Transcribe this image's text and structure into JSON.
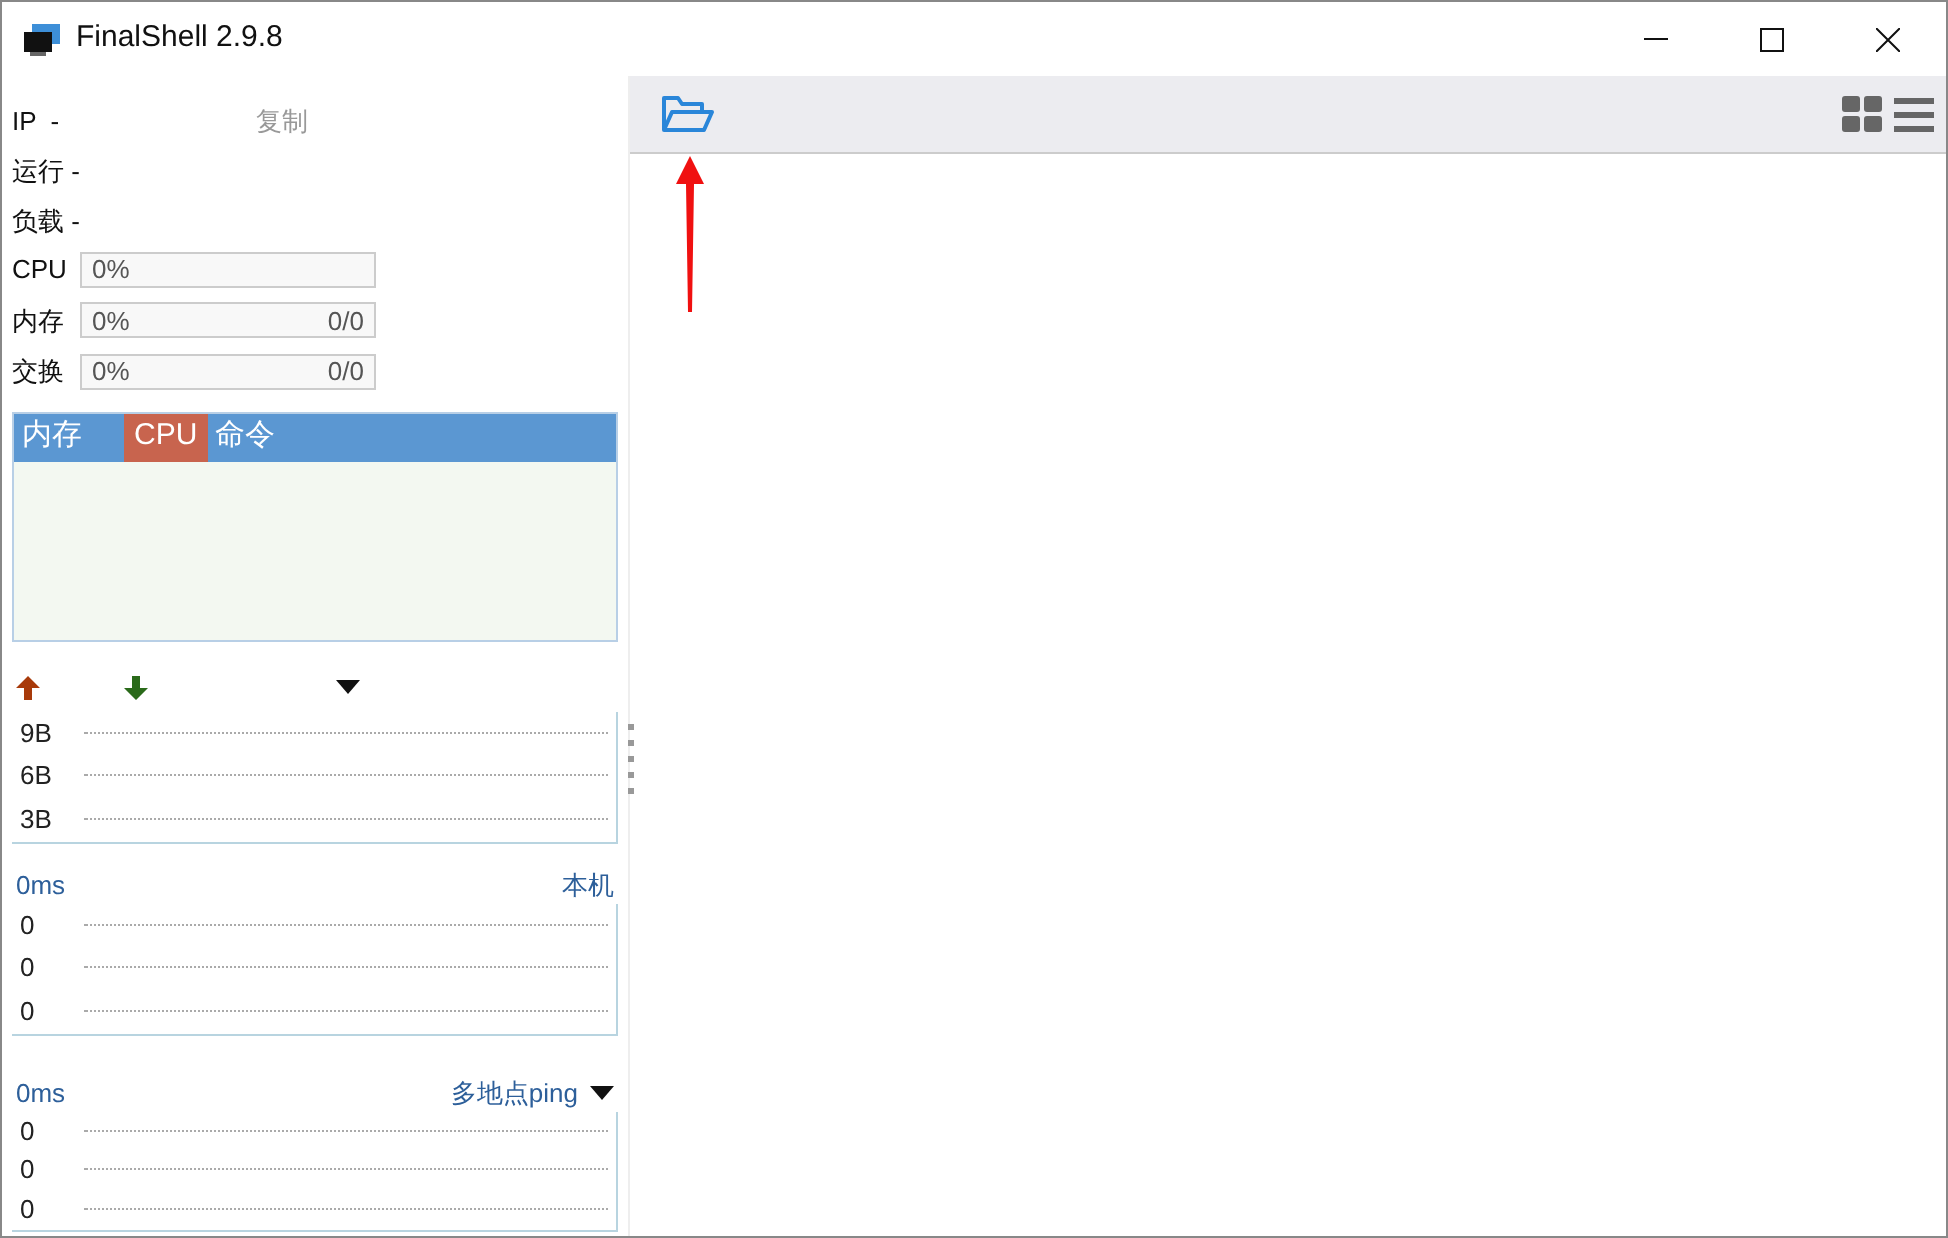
{
  "window": {
    "title": "FinalShell 2.9.8"
  },
  "info": [
    {
      "line": "IP  -",
      "action": "复制"
    },
    {
      "line": "运行 -"
    },
    {
      "line": "负载 -"
    }
  ],
  "meters": [
    {
      "label": "CPU",
      "percent": "0%"
    },
    {
      "label": "内存",
      "percent": "0%",
      "usage": "0/0"
    },
    {
      "label": "交换",
      "percent": "0%",
      "usage": "0/0"
    }
  ],
  "process_table": {
    "columns": [
      {
        "label": "内存",
        "selected": false
      },
      {
        "label": "CPU",
        "selected": true
      },
      {
        "label": "命令",
        "selected": false
      }
    ]
  },
  "network": {
    "y_labels": [
      "9B",
      "6B",
      "3B"
    ]
  },
  "latency": [
    {
      "reading": "0ms",
      "target": "本机",
      "dropdown": false,
      "y_labels": [
        "0",
        "0",
        "0"
      ]
    },
    {
      "reading": "0ms",
      "target": "多地点ping",
      "dropdown": true,
      "y_labels": [
        "0",
        "0",
        "0"
      ]
    }
  ]
}
